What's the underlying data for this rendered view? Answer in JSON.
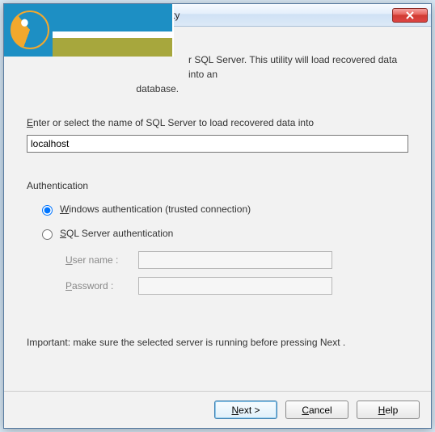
{
  "titlebar": {
    "title_fragment": "ility"
  },
  "intro": {
    "line1": "r SQL Server. This utility will load recovered data into an",
    "line2_fragment": "                                     database."
  },
  "prompt": {
    "label_pre": "E",
    "label_rest": "nter or select the name of SQL Server to load recovered data into"
  },
  "server": {
    "value": "localhost"
  },
  "auth": {
    "section_label": "Authentication",
    "windows_pre": "W",
    "windows_rest": "indows authentication (trusted connection)",
    "windows_selected": true,
    "sql_pre": "S",
    "sql_rest": "QL Server authentication",
    "sql_selected": false,
    "user_label_pre": "U",
    "user_label_rest": "ser name :",
    "pass_label_pre": "P",
    "pass_label_rest": "assword :"
  },
  "important": "Important: make sure the selected server is running before pressing Next .",
  "buttons": {
    "next_pre": "N",
    "next_rest": "ext >",
    "cancel_pre": "C",
    "cancel_rest": "ancel",
    "help_pre": "H",
    "help_rest": "elp"
  }
}
